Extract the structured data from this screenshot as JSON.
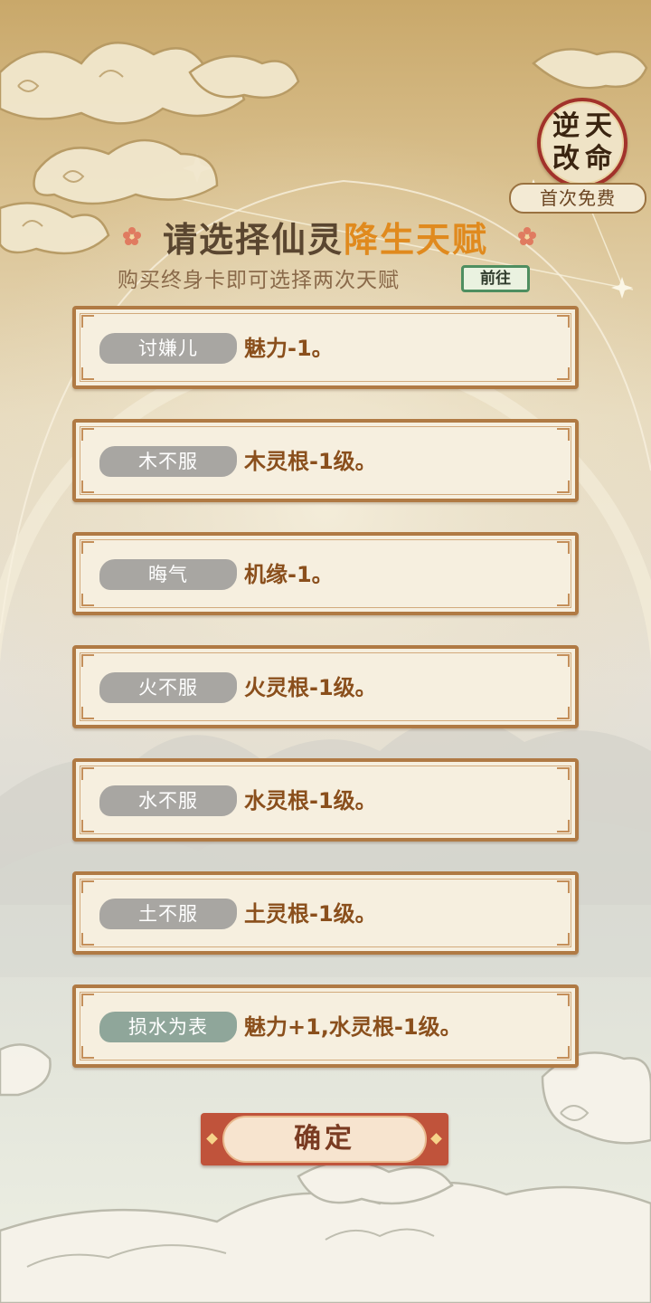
{
  "seal": {
    "chars": [
      "逆",
      "天",
      "改",
      "命"
    ],
    "badge": "首次免费"
  },
  "title": {
    "prefix": "请选择仙灵",
    "highlight": "降生天赋"
  },
  "subtitle": "购买终身卡即可选择两次天赋",
  "goto_button": "前往",
  "talents": [
    {
      "tag": "讨嫌儿",
      "desc": "魅力-1。",
      "kind": "negative"
    },
    {
      "tag": "木不服",
      "desc": "木灵根-1级。",
      "kind": "negative"
    },
    {
      "tag": "晦气",
      "desc": "机缘-1。",
      "kind": "negative"
    },
    {
      "tag": "火不服",
      "desc": "火灵根-1级。",
      "kind": "negative"
    },
    {
      "tag": "水不服",
      "desc": "水灵根-1级。",
      "kind": "negative"
    },
    {
      "tag": "土不服",
      "desc": "土灵根-1级。",
      "kind": "negative"
    },
    {
      "tag": "损水为表",
      "desc": "魅力+1,水灵根-1级。",
      "kind": "mixed"
    }
  ],
  "confirm_button": "确定",
  "colors": {
    "title_highlight": "#e08a1e",
    "card_border": "#b07a44",
    "negative_tag": "#a8a6a2",
    "mixed_tag": "#8fa69a",
    "confirm": "#c0533b"
  }
}
